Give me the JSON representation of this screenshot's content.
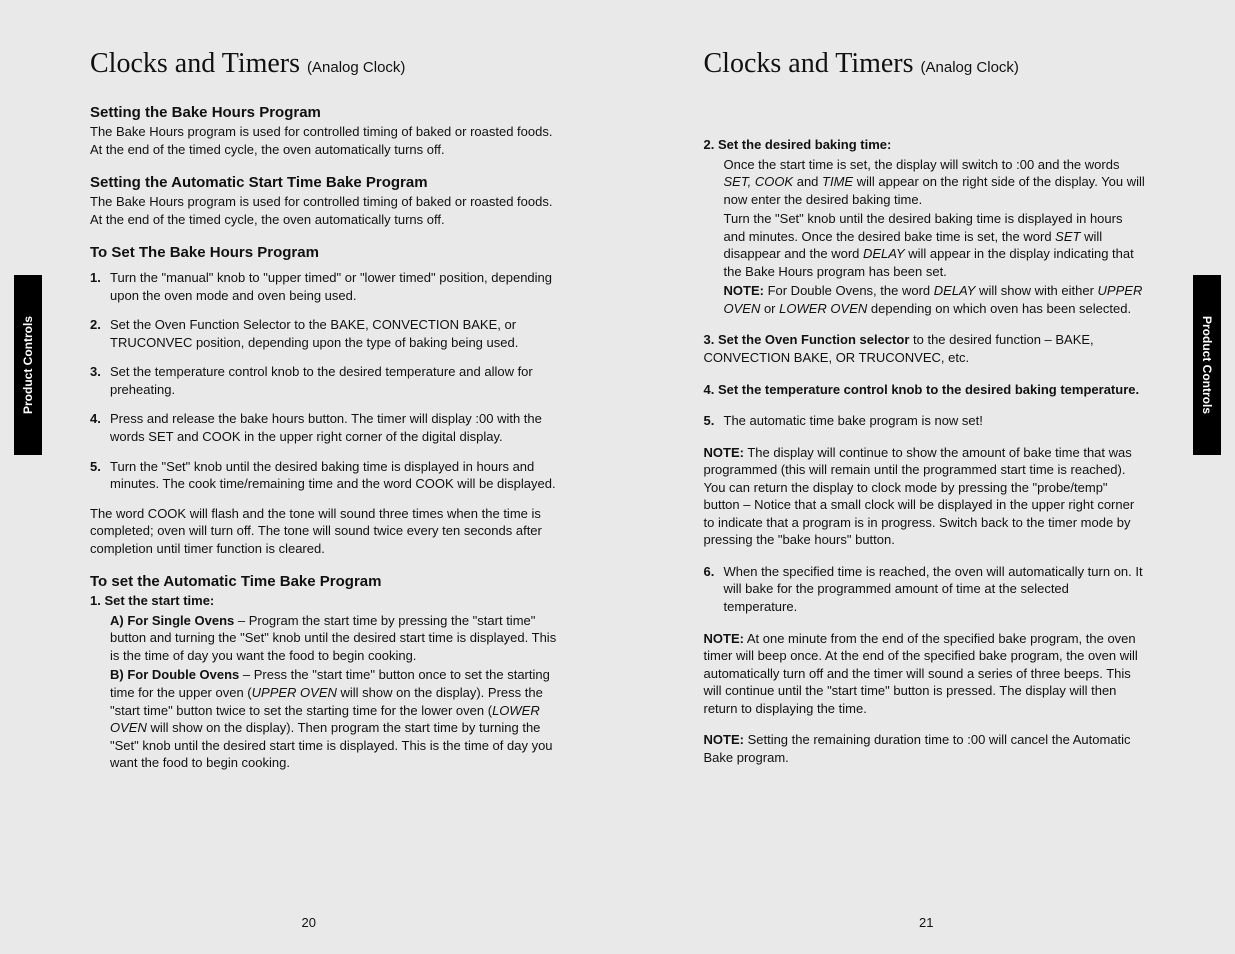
{
  "left": {
    "title_main": "Clocks and Timers",
    "title_sub": "(Analog Clock)",
    "tab": "Product Controls",
    "h_bake": "Setting the Bake Hours Program",
    "p_bake": "The Bake Hours program is used for controlled timing of baked or roasted foods. At the end of the timed cycle, the oven automatically turns off.",
    "h_auto": "Setting the Automatic Start Time Bake Program",
    "p_auto": "The Bake Hours program is used for controlled timing of baked or roasted foods. At the end of the timed cycle, the oven automatically turns off.",
    "h_set": "To Set The Bake Hours Program",
    "steps": [
      "Turn the \"manual\" knob to \"upper timed\" or \"lower timed\" position, depending upon the oven mode and oven being used.",
      "Set the Oven Function Selector to the BAKE, CONVECTION BAKE, or TRUCONVEC position, depending upon the type of baking being used.",
      "Set the temperature control knob to the desired temperature and allow for preheating.",
      "Press and release the bake hours button. The timer will display :00 with the words SET and COOK in the upper right corner of the digital display.",
      "Turn the \"Set\" knob until the desired baking time is displayed in hours and minutes. The cook time/remaining time and the word COOK will be displayed."
    ],
    "after": "The word COOK will flash and the tone will sound three times when the time is completed; oven will turn off. The tone will sound twice every ten seconds after completion until timer function is cleared.",
    "h_autoset": "To set the Automatic Time Bake Program",
    "start_lead": "1.  Set the start time:",
    "start_a_label": "A) For Single Ovens",
    "start_a_body": " – Program the start time by pressing the \"start time\" button and turning the \"Set\" knob until the desired start time is displayed. This is the time of day you want the food to begin cooking.",
    "start_b_label": "B) For Double Ovens",
    "start_b_body_1": " – Press the \"start time\" button once to set the starting time for the upper oven (",
    "start_b_upper": "UPPER OVEN",
    "start_b_body_2": " will show on the display). Press the \"start time\" button twice to set the starting time for the lower oven (",
    "start_b_lower": "LOWER OVEN",
    "start_b_body_3": "     will show on the display). Then program the start time by turning the \"Set\" knob until the desired start time is displayed. This is the time of day you want the food to begin cooking.",
    "pagenum": "20"
  },
  "right": {
    "title_main": "Clocks and Timers",
    "title_sub": "(Analog Clock)",
    "tab": "Product Controls",
    "s2_lead": "2.  Set the desired baking time:",
    "s2_body_1": "Once the start time is set, the display will switch to :00 and the words ",
    "s2_i1": "SET, COOK",
    "s2_body_2": " and ",
    "s2_i2": "TIME",
    "s2_body_3": " will appear on the right side of the display. You will now enter the desired baking time.",
    "s2_body_4a": "Turn the \"Set\" knob until the desired baking time is displayed in hours and minutes. Once the desired bake time is set, the word ",
    "s2_i3": "SET",
    "s2_body_4b": " will disappear and the word ",
    "s2_i4": "DELAY",
    "s2_body_4c": " will appear in the display indicating that the Bake Hours program has been set.",
    "s2_note_label": "NOTE:",
    "s2_note_1": " For Double Ovens, the word ",
    "s2_i5": "DELAY",
    "s2_note_2": " will show with either ",
    "s2_i6": "UPPER OVEN",
    "s2_note_3": " or ",
    "s2_i7": "LOWER OVEN",
    "s2_note_4": " depending on which oven has been selected.",
    "s3_lead": "3.  Set the Oven Function selector",
    "s3_body": " to the desired function – BAKE, CONVECTION BAKE, OR TRUCONVEC, etc.",
    "s4_lead": "4.  Set the temperature control knob to the desired baking temperature.",
    "s5_num": "5.",
    "s5_body": "The automatic time bake program is now set!",
    "note1_label": "NOTE:",
    "note1_body": " The display will continue to show the amount of bake time that was programmed (this will remain until the programmed start time is reached). You can return the display to clock mode by pressing the \"probe/temp\" button –  Notice that a small clock will be displayed in the upper right corner to indicate that a program is in progress. Switch back to the timer mode by pressing the        \"bake hours\" button.",
    "s6_num": "6.",
    "s6_body": "When the specified time is reached, the oven will automatically turn on. It will bake for the programmed amount of time at the selected temperature.",
    "note2_label": "NOTE:",
    "note2_body": " At one minute from the end of the specified bake program, the oven timer will beep once. At the end of the specified bake program, the oven will automatically turn off and the timer will sound a series of three beeps. This will continue until the \"start time\" button is pressed. The display will then return to displaying the time.",
    "note3_label": "NOTE:",
    "note3_body": " Setting the remaining duration time to :00 will cancel the Automatic Bake program.",
    "pagenum": "21"
  }
}
